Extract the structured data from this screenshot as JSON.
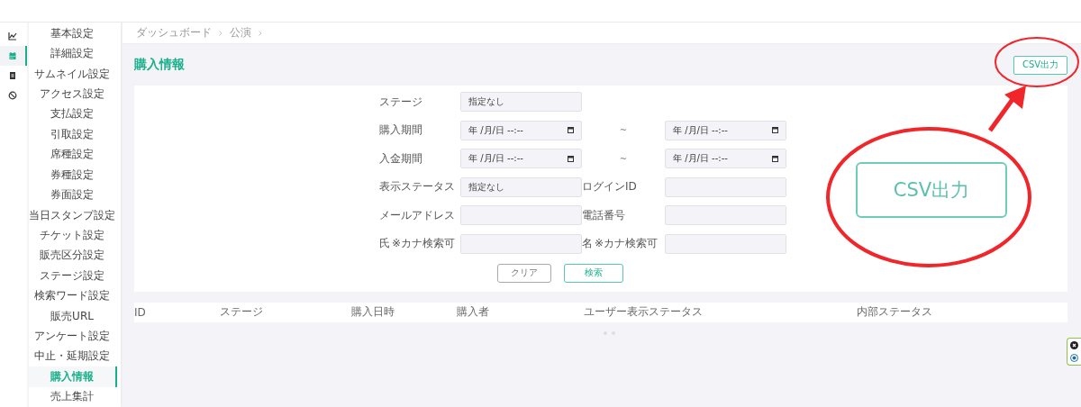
{
  "rail": [
    {
      "kind": "chart",
      "selected": false
    },
    {
      "kind": "calendar",
      "selected": true
    },
    {
      "kind": "document",
      "selected": false
    },
    {
      "kind": "ban",
      "selected": false
    }
  ],
  "sidebar": {
    "items": [
      {
        "label": "基本設定",
        "selected": false
      },
      {
        "label": "詳細設定",
        "selected": false
      },
      {
        "label": "サムネイル設定",
        "selected": false
      },
      {
        "label": "アクセス設定",
        "selected": false
      },
      {
        "label": "支払設定",
        "selected": false
      },
      {
        "label": "引取設定",
        "selected": false
      },
      {
        "label": "席種設定",
        "selected": false
      },
      {
        "label": "券種設定",
        "selected": false
      },
      {
        "label": "券面設定",
        "selected": false
      },
      {
        "label": "当日スタンプ設定",
        "selected": false
      },
      {
        "label": "チケット設定",
        "selected": false
      },
      {
        "label": "販売区分設定",
        "selected": false
      },
      {
        "label": "ステージ設定",
        "selected": false
      },
      {
        "label": "検索ワード設定",
        "selected": false
      },
      {
        "label": "販売URL",
        "selected": false
      },
      {
        "label": "アンケート設定",
        "selected": false
      },
      {
        "label": "中止・延期設定",
        "selected": false
      },
      {
        "label": "購入情報",
        "selected": true
      },
      {
        "label": "売上集計",
        "selected": false
      }
    ]
  },
  "breadcrumb": [
    "ダッシュボード",
    "公演"
  ],
  "title": "購入情報",
  "csv_button": "CSV出力",
  "filters": [
    {
      "kind": "single",
      "label": "ステージ",
      "value": "指定なし"
    },
    {
      "kind": "range",
      "label": "購入期間",
      "from": "年 /月/日 --:--",
      "separator": "~",
      "to": "年 /月/日 --:--"
    },
    {
      "kind": "range",
      "label": "入金期間",
      "from": "年 /月/日 --:--",
      "separator": "~",
      "to": "年 /月/日 --:--"
    },
    {
      "kind": "pair",
      "label": "表示ステータス",
      "value": "指定なし",
      "label2": "ログインID"
    },
    {
      "kind": "pair",
      "label": "メールアドレス",
      "label2": "電話番号"
    },
    {
      "kind": "pair",
      "label": "氏",
      "note": "※カナ検索可",
      "label2": "名",
      "note2": "※カナ検索可"
    }
  ],
  "buttons": {
    "clear": "クリア",
    "search": "検索"
  },
  "table": {
    "columns": [
      "ID",
      "ステージ",
      "購入日時",
      "購入者",
      "ユーザー表示ステータス",
      "内部ステータス"
    ]
  },
  "annotation": {
    "callout_text": "CSV出力"
  }
}
